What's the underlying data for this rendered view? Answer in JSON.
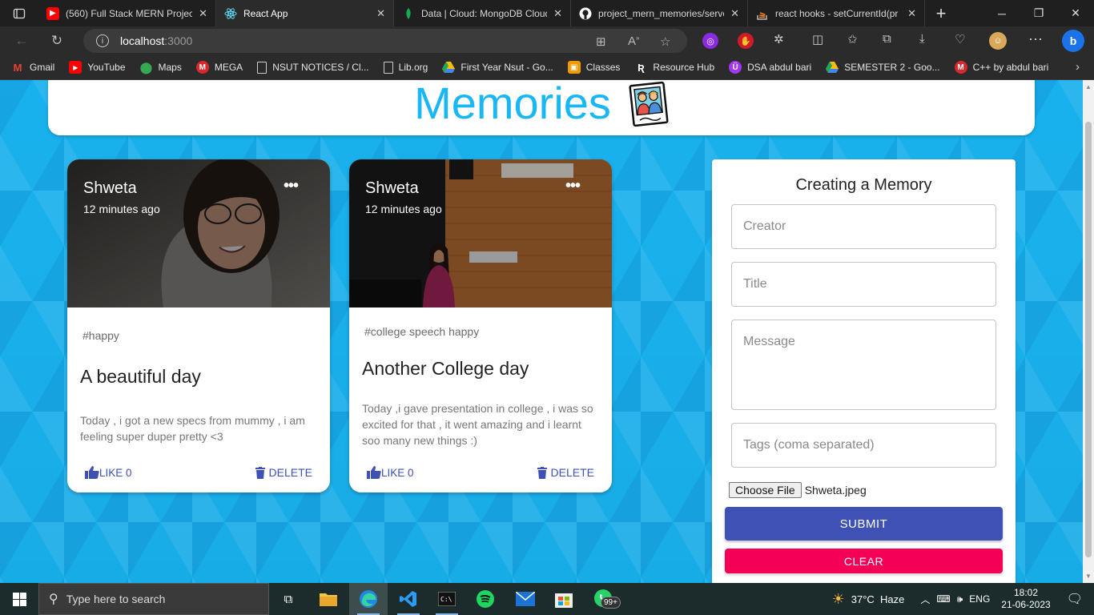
{
  "browser": {
    "tabs": [
      {
        "title": "(560) Full Stack MERN Project",
        "icon": "youtube-icon",
        "color": "#ff0000",
        "active": false
      },
      {
        "title": "React App",
        "icon": "react-icon",
        "color": "#61dafb",
        "active": true
      },
      {
        "title": "Data | Cloud: MongoDB Cloud",
        "icon": "mongodb-leaf-icon",
        "color": "#13aa52",
        "active": false
      },
      {
        "title": "project_mern_memories/serve",
        "icon": "github-icon",
        "color": "#ffffff",
        "active": false
      },
      {
        "title": "react hooks - setCurrentId(pr",
        "icon": "stackoverflow-icon",
        "color": "#f48024",
        "active": false
      }
    ],
    "url_host": "localhost",
    "url_port": ":3000",
    "bookmarks": [
      {
        "label": "Gmail",
        "icon": "gmail-icon",
        "color": "#ea4335"
      },
      {
        "label": "YouTube",
        "icon": "youtube-icon",
        "color": "#ff0000"
      },
      {
        "label": "Maps",
        "icon": "maps-pin-icon",
        "color": "#34a853"
      },
      {
        "label": "MEGA",
        "icon": "mega-icon",
        "color": "#d9272e"
      },
      {
        "label": "NSUT NOTICES / Cl...",
        "icon": "page-icon",
        "color": "#cccccc"
      },
      {
        "label": "Lib.org",
        "icon": "page-icon",
        "color": "#cccccc"
      },
      {
        "label": "First Year Nsut - Go...",
        "icon": "drive-icon",
        "color": "#fbbc04"
      },
      {
        "label": "Classes",
        "icon": "classroom-icon",
        "color": "#f29900"
      },
      {
        "label": "Resource Hub",
        "icon": "resourcehub-icon",
        "color": "#ffffff"
      },
      {
        "label": "DSA abdul bari",
        "icon": "udemy-icon",
        "color": "#a435f0"
      },
      {
        "label": "SEMESTER 2 - Goo...",
        "icon": "drive-icon",
        "color": "#fbbc04"
      },
      {
        "label": "C++ by abdul bari",
        "icon": "mega-icon",
        "color": "#d9272e"
      }
    ]
  },
  "app": {
    "title": "Memories",
    "accent": "#1ab7f5",
    "posts": [
      {
        "creator": "Shweta",
        "time": "12 minutes ago",
        "tags": "#happy",
        "title": "A beautiful day",
        "message": "Today , i got a new specs from mummy , i am feeling super duper pretty <3",
        "like_label": "LIKE 0",
        "delete_label": "DELETE"
      },
      {
        "creator": "Shweta",
        "time": "12 minutes ago",
        "tags": "#college speech happy",
        "title": "Another College day",
        "message": "Today ,i gave presentation in college , i was so excited for that , it went amazing and i learnt soo many new things :)",
        "like_label": "LIKE 0",
        "delete_label": "DELETE"
      }
    ],
    "form": {
      "heading": "Creating a Memory",
      "creator_placeholder": "Creator",
      "title_placeholder": "Title",
      "message_placeholder": "Message",
      "tags_placeholder": "Tags (coma separated)",
      "choose_file_label": "Choose File",
      "file_name": "Shweta.jpeg",
      "submit_label": "SUBMIT",
      "clear_label": "CLEAR",
      "submit_color": "#3f51b5",
      "clear_color": "#f50057"
    }
  },
  "taskbar": {
    "search_placeholder": "Type here to search",
    "weather": "37°C  Haze",
    "language": "ENG",
    "time": "18:02",
    "date": "21-06-2023",
    "whatsapp_badge": "99+"
  }
}
